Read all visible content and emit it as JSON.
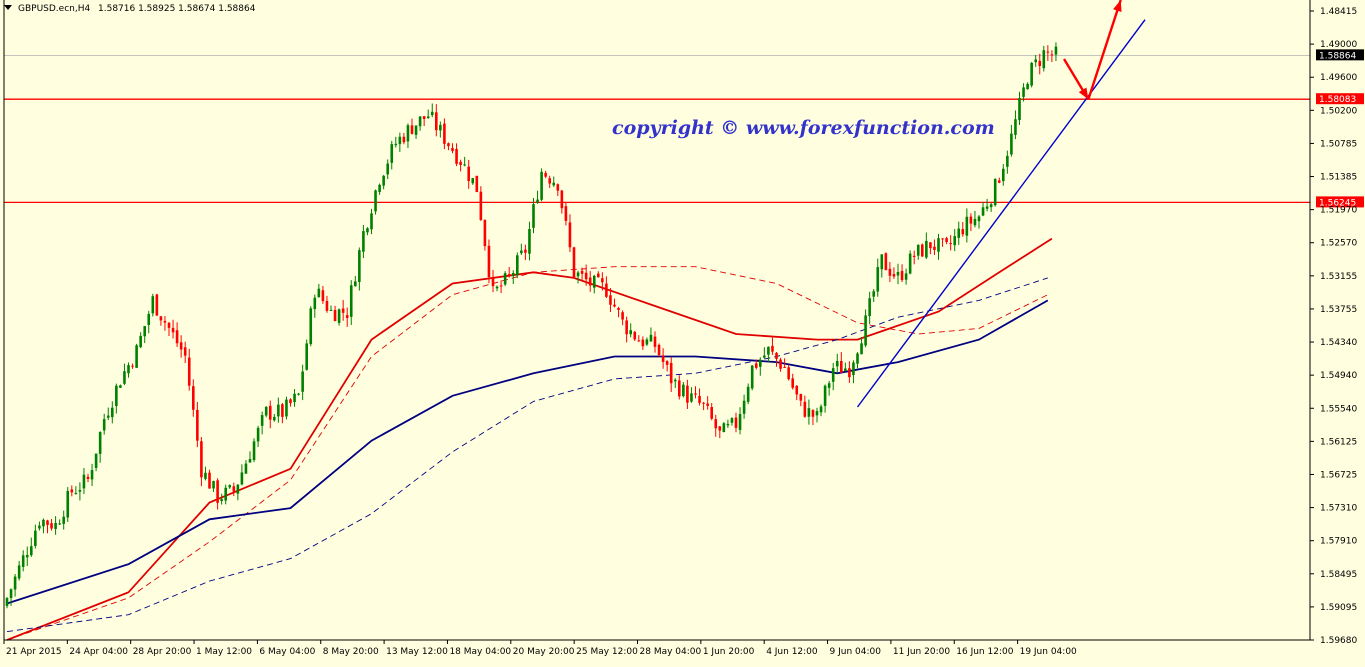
{
  "header": {
    "symbol": "GBPUSD.ecn,H4",
    "ohlc": "1.58716 1.58925 1.58674 1.58864",
    "menu_icon": "triangle-down-icon"
  },
  "watermark": "copyright  ©  www.forexfunction.com",
  "colors": {
    "background": "#FFFFE0",
    "bull": "#008000",
    "bear": "#FF0000",
    "ma_red": "#E00000",
    "ma_navy": "#000080",
    "trendline": "#0000CC",
    "level": "#FF0000",
    "arrow": "#FF0000"
  },
  "chart_data": {
    "type": "candlestick",
    "symbol": "GBPUSD.ecn",
    "timeframe": "H4",
    "ylim": [
      1.4845,
      1.5985
    ],
    "y_ticks": [
      "1.59680",
      "1.59095",
      "1.58495",
      "1.57910",
      "1.57310",
      "1.56725",
      "1.56125",
      "1.55540",
      "1.54940",
      "1.54340",
      "1.53755",
      "1.53155",
      "1.52570",
      "1.51970",
      "1.51385",
      "1.50785",
      "1.50200",
      "1.49600",
      "1.49000",
      "1.48415"
    ],
    "x_ticks": [
      "21 Apr 2015",
      "24 Apr 04:00",
      "28 Apr 20:00",
      "1 May 12:00",
      "6 May 04:00",
      "8 May 20:00",
      "13 May 12:00",
      "18 May 04:00",
      "20 May 20:00",
      "25 May 12:00",
      "28 May 04:00",
      "1 Jun 20:00",
      "4 Jun 12:00",
      "9 Jun 04:00",
      "11 Jun 20:00",
      "16 Jun 12:00",
      "19 Jun 04:00"
    ],
    "current_price": "1.58864",
    "levels": [
      {
        "value": 1.58083,
        "label": "1.58083"
      },
      {
        "value": 1.56245,
        "label": "1.56245"
      }
    ],
    "close_path": [
      [
        0,
        1.492
      ],
      [
        4,
        1.499
      ],
      [
        8,
        1.506
      ],
      [
        12,
        1.505
      ],
      [
        16,
        1.511
      ],
      [
        20,
        1.513
      ],
      [
        24,
        1.524
      ],
      [
        28,
        1.531
      ],
      [
        32,
        1.536
      ],
      [
        36,
        1.545
      ],
      [
        40,
        1.54
      ],
      [
        44,
        1.535
      ],
      [
        48,
        1.515
      ],
      [
        52,
        1.51
      ],
      [
        56,
        1.511
      ],
      [
        60,
        1.518
      ],
      [
        64,
        1.525
      ],
      [
        68,
        1.525
      ],
      [
        72,
        1.528
      ],
      [
        76,
        1.547
      ],
      [
        80,
        1.543
      ],
      [
        84,
        1.543
      ],
      [
        88,
        1.557
      ],
      [
        92,
        1.567
      ],
      [
        96,
        1.573
      ],
      [
        100,
        1.576
      ],
      [
        104,
        1.578
      ],
      [
        108,
        1.574
      ],
      [
        112,
        1.57
      ],
      [
        116,
        1.565
      ],
      [
        120,
        1.546
      ],
      [
        124,
        1.549
      ],
      [
        128,
        1.554
      ],
      [
        132,
        1.568
      ],
      [
        136,
        1.566
      ],
      [
        140,
        1.55
      ],
      [
        144,
        1.548
      ],
      [
        148,
        1.547
      ],
      [
        152,
        1.541
      ],
      [
        156,
        1.538
      ],
      [
        160,
        1.537
      ],
      [
        164,
        1.531
      ],
      [
        168,
        1.528
      ],
      [
        172,
        1.526
      ],
      [
        176,
        1.521
      ],
      [
        180,
        1.523
      ],
      [
        184,
        1.533
      ],
      [
        188,
        1.536
      ],
      [
        192,
        1.533
      ],
      [
        196,
        1.526
      ],
      [
        200,
        1.524
      ],
      [
        204,
        1.533
      ],
      [
        208,
        1.533
      ],
      [
        212,
        1.541
      ],
      [
        216,
        1.552
      ],
      [
        220,
        1.549
      ],
      [
        224,
        1.553
      ],
      [
        228,
        1.555
      ],
      [
        232,
        1.554
      ],
      [
        236,
        1.558
      ],
      [
        240,
        1.56
      ],
      [
        244,
        1.565
      ],
      [
        248,
        1.574
      ],
      [
        252,
        1.585
      ],
      [
        256,
        1.589
      ],
      [
        259,
        1.5886
      ]
    ],
    "moving_averages": [
      {
        "style": "solid",
        "color": "#E00000",
        "points": [
          [
            0,
            1.4845
          ],
          [
            30,
            1.493
          ],
          [
            50,
            1.509
          ],
          [
            70,
            1.515
          ],
          [
            90,
            1.538
          ],
          [
            110,
            1.548
          ],
          [
            130,
            1.55
          ],
          [
            140,
            1.549
          ],
          [
            160,
            1.544
          ],
          [
            180,
            1.539
          ],
          [
            200,
            1.538
          ],
          [
            210,
            1.538
          ],
          [
            230,
            1.543
          ],
          [
            245,
            1.55
          ],
          [
            258,
            1.556
          ]
        ]
      },
      {
        "style": "dashed",
        "color": "#E00000",
        "points": [
          [
            0,
            1.4845
          ],
          [
            30,
            1.492
          ],
          [
            50,
            1.502
          ],
          [
            70,
            1.513
          ],
          [
            90,
            1.535
          ],
          [
            110,
            1.546
          ],
          [
            130,
            1.55
          ],
          [
            150,
            1.551
          ],
          [
            170,
            1.551
          ],
          [
            190,
            1.548
          ],
          [
            210,
            1.541
          ],
          [
            225,
            1.539
          ],
          [
            240,
            1.54
          ],
          [
            257,
            1.546
          ]
        ]
      },
      {
        "style": "solid",
        "color": "#000080",
        "points": [
          [
            0,
            1.491
          ],
          [
            30,
            1.498
          ],
          [
            50,
            1.506
          ],
          [
            70,
            1.508
          ],
          [
            90,
            1.52
          ],
          [
            110,
            1.528
          ],
          [
            130,
            1.532
          ],
          [
            150,
            1.535
          ],
          [
            170,
            1.535
          ],
          [
            190,
            1.534
          ],
          [
            205,
            1.532
          ],
          [
            220,
            1.534
          ],
          [
            240,
            1.538
          ],
          [
            257,
            1.545
          ]
        ]
      },
      {
        "style": "dashed",
        "color": "#000080",
        "points": [
          [
            0,
            1.486
          ],
          [
            30,
            1.489
          ],
          [
            50,
            1.495
          ],
          [
            70,
            1.499
          ],
          [
            90,
            1.507
          ],
          [
            110,
            1.518
          ],
          [
            130,
            1.527
          ],
          [
            150,
            1.531
          ],
          [
            170,
            1.532
          ],
          [
            190,
            1.535
          ],
          [
            205,
            1.538
          ],
          [
            220,
            1.542
          ],
          [
            240,
            1.545
          ],
          [
            257,
            1.549
          ]
        ]
      }
    ],
    "trendline": {
      "from": [
        210,
        1.526
      ],
      "to": [
        281,
        1.595
      ]
    },
    "projection_arrows": [
      {
        "from": [
          261,
          1.588
        ],
        "to": [
          267,
          1.5808
        ]
      },
      {
        "from": [
          267,
          1.5808
        ],
        "to": [
          275,
          1.5985
        ]
      }
    ]
  }
}
